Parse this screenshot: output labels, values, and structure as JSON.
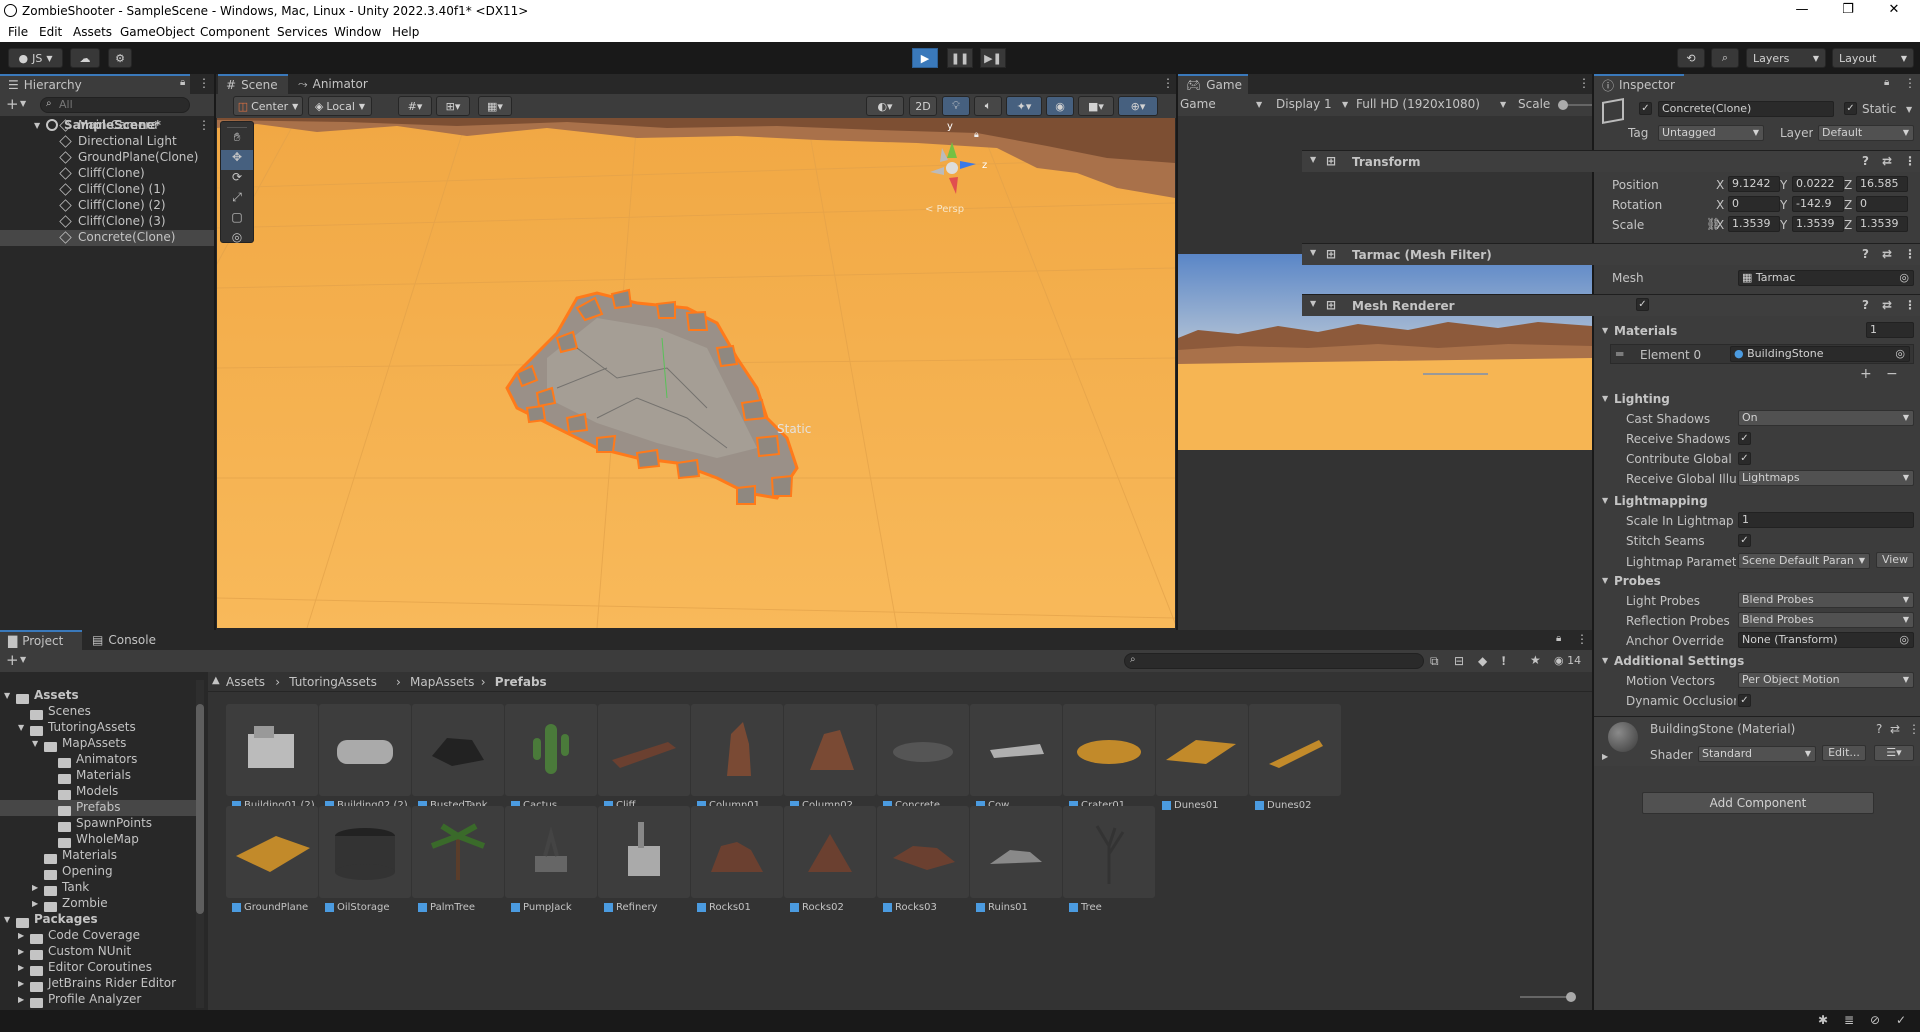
{
  "title": "ZombieShooter - SampleScene - Windows, Mac, Linux - Unity 2022.3.40f1* <DX11>",
  "menu": [
    "File",
    "Edit",
    "Assets",
    "GameObject",
    "Component",
    "Services",
    "Window",
    "Help"
  ],
  "toolbar": {
    "account": "JS",
    "layers": "Layers",
    "layout": "Layout"
  },
  "hierarchy": {
    "tab": "Hierarchy",
    "search_placeholder": "All",
    "scene": "SampleScene*",
    "items": [
      "Main Camera",
      "Directional Light",
      "GroundPlane(Clone)",
      "Cliff(Clone)",
      "Cliff(Clone) (1)",
      "Cliff(Clone) (2)",
      "Cliff(Clone) (3)",
      "Concrete(Clone)"
    ]
  },
  "scene": {
    "tabs": [
      "Scene",
      "Animator"
    ],
    "pivot": "Center",
    "space": "Local",
    "mode2d": "2D",
    "static_label": "Static",
    "gizmo_y": "y",
    "gizmo_z": "z",
    "gizmo_persp": "< Persp"
  },
  "game": {
    "tab": "Game",
    "mode": "Game",
    "display": "Display 1",
    "resolution": "Full HD (1920x1080)",
    "scale": "Scale"
  },
  "inspector": {
    "tab": "Inspector",
    "object_name": "Concrete(Clone)",
    "static": "Static",
    "tag_label": "Tag",
    "tag": "Untagged",
    "layer_label": "Layer",
    "layer": "Default",
    "transform": {
      "title": "Transform",
      "position": {
        "label": "Position",
        "x": "9.1242",
        "y": "0.0222",
        "z": "16.585"
      },
      "rotation": {
        "label": "Rotation",
        "x": "0",
        "y": "-142.9",
        "z": "0"
      },
      "scale": {
        "label": "Scale",
        "x": "1.3539",
        "y": "1.3539",
        "z": "1.3539"
      }
    },
    "mesh_filter": {
      "title": "Tarmac (Mesh Filter)",
      "mesh_label": "Mesh",
      "mesh": "Tarmac"
    },
    "mesh_renderer": {
      "title": "Mesh Renderer",
      "materials_label": "Materials",
      "materials_count": "1",
      "element0_label": "Element 0",
      "element0": "BuildingStone",
      "lighting": "Lighting",
      "cast_shadows_label": "Cast Shadows",
      "cast_shadows": "On",
      "receive_shadows_label": "Receive Shadows",
      "contribute_gi_label": "Contribute Global I",
      "receive_gi_label": "Receive Global Illu",
      "receive_gi": "Lightmaps",
      "lightmapping": "Lightmapping",
      "scale_lightmap_label": "Scale In Lightmap",
      "scale_lightmap": "1",
      "stitch_label": "Stitch Seams",
      "lightmap_params_label": "Lightmap Paramete",
      "lightmap_params": "Scene Default Paran",
      "view": "View",
      "probes": "Probes",
      "light_probes_label": "Light Probes",
      "light_probes": "Blend Probes",
      "reflection_probes_label": "Reflection Probes",
      "reflection_probes": "Blend Probes",
      "anchor_label": "Anchor Override",
      "anchor": "None (Transform)",
      "additional": "Additional Settings",
      "motion_label": "Motion Vectors",
      "motion": "Per Object Motion",
      "dynamic_label": "Dynamic Occlusior"
    },
    "material": {
      "title": "BuildingStone (Material)",
      "shader_label": "Shader",
      "shader": "Standard",
      "edit": "Edit..."
    },
    "add_component": "Add Component"
  },
  "project": {
    "tabs": [
      "Project",
      "Console"
    ],
    "breadcrumb": [
      "Assets",
      "TutoringAssets",
      "MapAssets",
      "Prefabs"
    ],
    "hidden_count": "14",
    "tree": [
      {
        "label": "Assets",
        "indent": 0,
        "bold": true
      },
      {
        "label": "Scenes",
        "indent": 1
      },
      {
        "label": "TutoringAssets",
        "indent": 1
      },
      {
        "label": "MapAssets",
        "indent": 2
      },
      {
        "label": "Animators",
        "indent": 3
      },
      {
        "label": "Materials",
        "indent": 3
      },
      {
        "label": "Models",
        "indent": 3
      },
      {
        "label": "Prefabs",
        "indent": 3,
        "selected": true
      },
      {
        "label": "SpawnPoints",
        "indent": 3
      },
      {
        "label": "WholeMap",
        "indent": 3
      },
      {
        "label": "Materials",
        "indent": 2
      },
      {
        "label": "Opening",
        "indent": 2
      },
      {
        "label": "Tank",
        "indent": 2
      },
      {
        "label": "Zombie",
        "indent": 2
      },
      {
        "label": "Packages",
        "indent": 0,
        "bold": true
      },
      {
        "label": "Code Coverage",
        "indent": 1
      },
      {
        "label": "Custom NUnit",
        "indent": 1
      },
      {
        "label": "Editor Coroutines",
        "indent": 1
      },
      {
        "label": "JetBrains Rider Editor",
        "indent": 1
      },
      {
        "label": "Profile Analyzer",
        "indent": 1
      }
    ],
    "assets": [
      "Building01 (2)",
      "Building02 (2)",
      "BustedTank",
      "Cactus",
      "Cliff",
      "Column01",
      "Column02",
      "Concrete",
      "Cow",
      "Crater01",
      "Dunes01",
      "Dunes02",
      "GroundPlane",
      "OilStorage",
      "PalmTree",
      "PumpJack",
      "Refinery",
      "Rocks01",
      "Rocks02",
      "Rocks03",
      "Ruins01",
      "Tree"
    ]
  },
  "colors": {
    "accent": "#3a79bb",
    "sand": "#f6b553",
    "selection": "#ff7a1a",
    "sky": "#5a86c7"
  }
}
